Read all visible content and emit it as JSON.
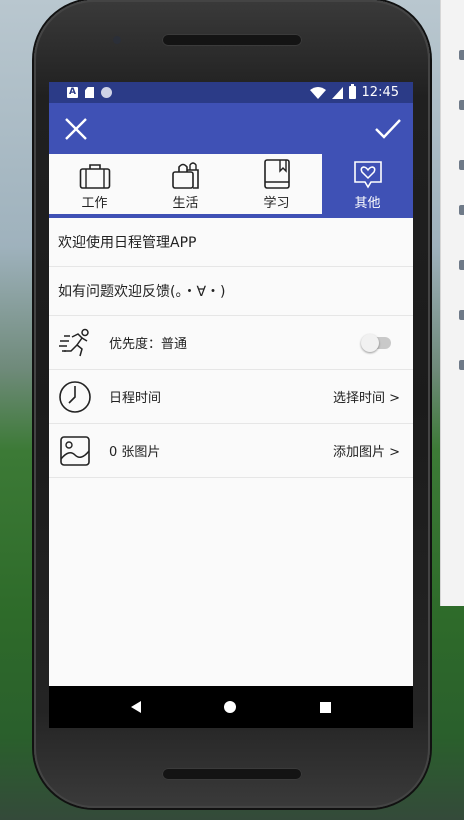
{
  "status_bar": {
    "time": "12:45"
  },
  "toolbar": {
    "close_icon": "close-icon",
    "confirm_icon": "check-icon",
    "color": "#3f51b5"
  },
  "tabs": [
    {
      "label": "工作",
      "icon": "briefcase-icon",
      "active": false
    },
    {
      "label": "生活",
      "icon": "shopping-bag-icon",
      "active": false
    },
    {
      "label": "学习",
      "icon": "book-icon",
      "active": false
    },
    {
      "label": "其他",
      "icon": "heart-chat-icon",
      "active": true
    }
  ],
  "content": {
    "welcome_text": "欢迎使用日程管理APP",
    "feedback_text": "如有问题欢迎反馈(。・∀・)",
    "priority": {
      "label": "优先度：普通",
      "icon": "running-icon",
      "toggle_on": false
    },
    "schedule_time": {
      "label": "日程时间",
      "action": "选择时间 >",
      "icon": "clock-icon"
    },
    "images": {
      "label": "0 张图片",
      "action": "添加图片 >",
      "icon": "image-icon"
    }
  }
}
